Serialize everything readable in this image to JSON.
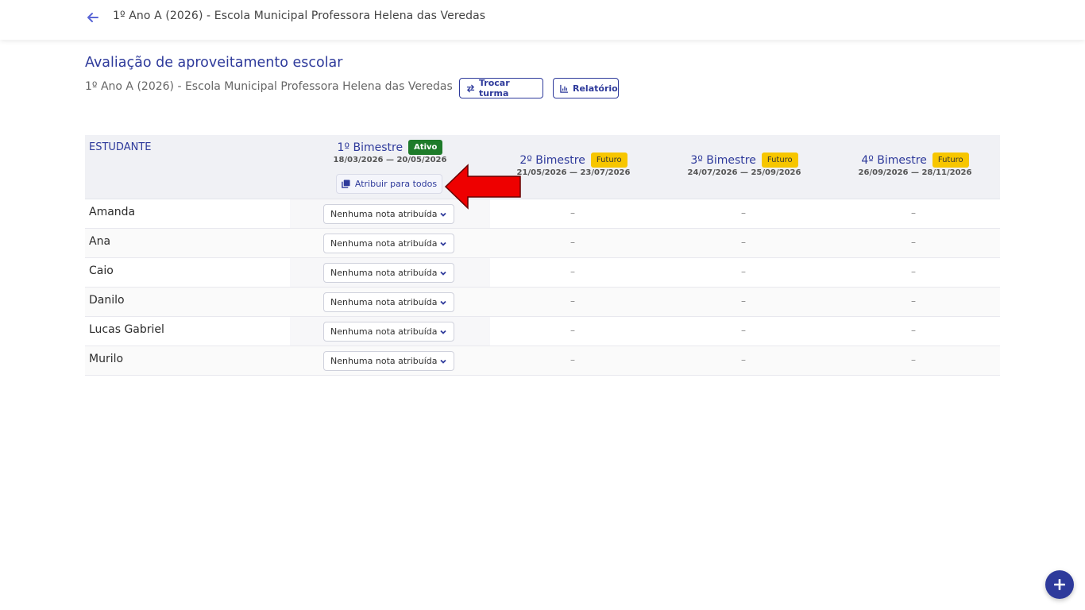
{
  "header": {
    "title": "1º Ano A (2026) - Escola Municipal Professora Helena das Veredas"
  },
  "page": {
    "title": "Avaliação de aproveitamento escolar",
    "subtitle": "1º Ano A (2026) - Escola Municipal Professora Helena das Veredas",
    "trocar_turma_label": "Trocar turma",
    "relatorio_label": "Relatório"
  },
  "table": {
    "student_header": "ESTUDANTE",
    "assign_all_label": "Atribuir para todos",
    "bimesters": [
      {
        "name": "1º Bimestre",
        "status": "Ativo",
        "dates": "18/03/2026 — 20/05/2026"
      },
      {
        "name": "2º Bimestre",
        "status": "Futuro",
        "dates": "21/05/2026 — 23/07/2026"
      },
      {
        "name": "3º Bimestre",
        "status": "Futuro",
        "dates": "24/07/2026 — 25/09/2026"
      },
      {
        "name": "4º Bimestre",
        "status": "Futuro",
        "dates": "26/09/2026 — 28/11/2026"
      }
    ],
    "empty_mark": "–",
    "rows": [
      {
        "student": "Amanda",
        "grade": "Nenhuma nota atribuída"
      },
      {
        "student": "Ana",
        "grade": "Nenhuma nota atribuída"
      },
      {
        "student": "Caio",
        "grade": "Nenhuma nota atribuída"
      },
      {
        "student": "Danilo",
        "grade": "Nenhuma nota atribuída"
      },
      {
        "student": "Lucas Gabriel",
        "grade": "Nenhuma nota atribuída"
      },
      {
        "student": "Murilo",
        "grade": "Nenhuma nota atribuída"
      }
    ]
  },
  "icons": {
    "back": "arrow-left-icon",
    "swap": "swap-icon",
    "report": "bar-chart-icon",
    "copy": "copy-icon",
    "chevron": "chevron-down-icon",
    "fab": "plus-icon",
    "annotation": "red-arrow-icon"
  },
  "colors": {
    "primary": "#2e3a9b",
    "active_badge": "#1e7b2a",
    "future_badge": "#f7c600",
    "annotation_arrow": "#ee0000"
  }
}
